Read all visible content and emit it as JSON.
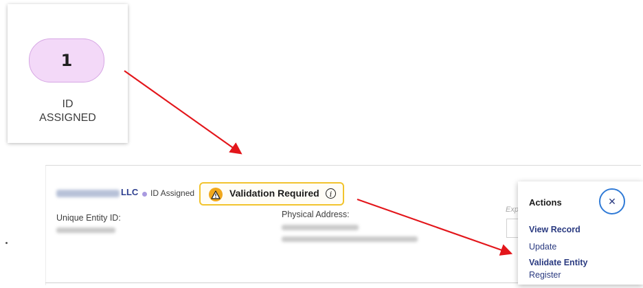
{
  "status_card": {
    "count": "1",
    "label_line1": "ID",
    "label_line2": "ASSIGNED"
  },
  "record": {
    "entity_name_suffix": "LLC",
    "status": "ID Assigned",
    "validation_badge": "Validation Required",
    "info_glyph": "i",
    "unique_entity_id_label": "Unique Entity ID:",
    "physical_address_label": "Physical Address:",
    "expiration_hint": "Exp"
  },
  "actions_menu": {
    "title": "Actions",
    "close_glyph": "✕",
    "items": [
      "View Record",
      "Update",
      "Validate Entity",
      "Register"
    ]
  },
  "colors": {
    "pill_fill": "#f3d9f8",
    "badge_border": "#f2c32c",
    "link": "#2a3a80",
    "arrow": "#e3161b",
    "focus_ring": "#2f7ad6"
  },
  "icons": [
    "warning-icon",
    "info-icon",
    "close-icon",
    "arrow"
  ]
}
